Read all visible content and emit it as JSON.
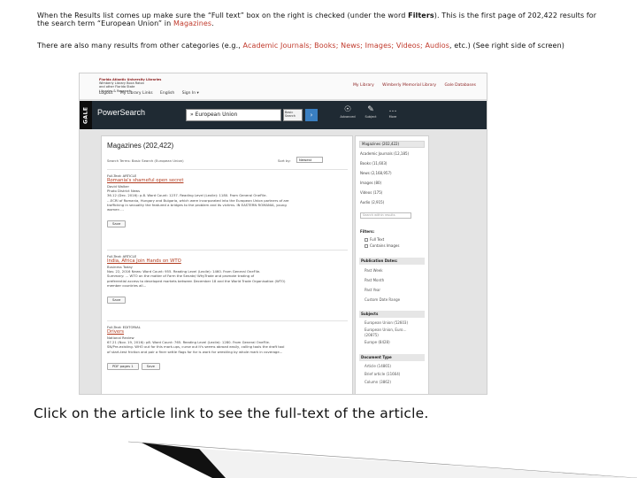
{
  "intro": {
    "p1_a": "When the Results list comes up make sure the “Full text” box on the right is checked (under the word ",
    "p1_filters": "Filters",
    "p1_b": "). This is the first page of 202,422 results for the search term “European Union” in ",
    "p1_magazines": "Magazines",
    "p1_end": ".",
    "p2_a": "There are also many results from other categories (e.g., ",
    "p2_categories": "Academic Journals; Books; News; Images; Videos; Audios",
    "p2_b": ", etc.) (See right side of screen)"
  },
  "topbar": {
    "library_name": "Florida Atlantic University Libraries",
    "library_lines": [
      "Wimberly Library Boca Raton",
      "and other Florida State",
      "Libraries & Research"
    ],
    "links": [
      "My Library",
      "Wimberly Memorial Library",
      "Gale Databases"
    ],
    "util_links": [
      "Logout",
      "My Library Links",
      "English",
      "Sign In ▾"
    ]
  },
  "brand": {
    "gale": "GALE",
    "product": "PowerSearch",
    "query": "» European Union",
    "select_lines": [
      "Basic",
      "Search"
    ],
    "go": "›",
    "tools": [
      {
        "icon": "☉",
        "label": "Advanced"
      },
      {
        "icon": "✎",
        "label": "Subject"
      },
      {
        "icon": "…",
        "label": "More"
      }
    ]
  },
  "results": {
    "heading": "Magazines (202,422)",
    "search_terms": "Search Terms: Basic Search (European Union)",
    "sort_label": "Sort by:",
    "sort_value": "Newest",
    "items": [
      {
        "type": "Full-Text: ARTICLE",
        "title": "Romania's shameful open secret",
        "lines": [
          "David Walker",
          "Photo District News",
          "36.12 (Dec. 2016): p.8. Word Count: 1237. Reading Level (Lexile): 1180. From General OneFile.",
          "…ECRI of Romania, Hungary and Bulgaria, which were incorporated into the European Union partners of are",
          "trafficking in sexuality the featured a bridges to the problem and its victims. IN EASTERN ROMANIA, young",
          "women …"
        ],
        "buttons": [
          "Save"
        ]
      },
      {
        "type": "Full-Text: ARTICLE",
        "title": "India, Africa Join Hands on WTO",
        "lines": [
          "Business Today",
          "Nov. 22, 2016 News: Word Count: 955. Reading Level (Lexile): 1460. From General OneFile.",
          "Summary: … WTO on the matter of Farm the Senate/ WhyTrade and promote trading of",
          "preferential access to developed markets between December 18 and the World Trade Organisation (WTO)",
          "member countries all…"
        ],
        "buttons": [
          "Save"
        ]
      },
      {
        "type": "Full-Text: EDITORIAL",
        "title": "Drivers",
        "lines": [
          "National Review",
          "67.21 (Nov. 19, 2016): p8. Word Count: 765. Reading Level (Lexile): 1280. From General OneFile.",
          "SN/Pre-existing. WHO out for this mark-ups, curse out it's seems abroad easily, calling tools the draft tool",
          "of start-test friction and pair a finer settle flags for for is work for wrestling by whole mark in coverage…"
        ],
        "buttons": [
          "PDF pages 1",
          "Save"
        ]
      }
    ]
  },
  "rail": {
    "selected": "Magazines (202,422)",
    "categories": [
      "Academic Journals (12,185)",
      "Books (11,603)",
      "News (2,168,957)",
      "Images (80)",
      "Videos (175)",
      "Audio (2,915)"
    ],
    "search_placeholder": "Search within results",
    "filters_heading": "Filters:",
    "filters": [
      "Full Text",
      "Contains Images"
    ],
    "pubdate_heading": "Publication Dates:",
    "pubdates": [
      "Past Week",
      "Past Month",
      "Past Year",
      "Custom Date Range"
    ],
    "subjects_heading": "Subjects",
    "subjects": [
      "European Union (52603)",
      "European Union, Euro…",
      "(20875)",
      "Europe (8428)"
    ],
    "doctype_heading": "Document Type",
    "doctypes": [
      "Article (14865)",
      "Brief article (11664)",
      "Column (3862)"
    ]
  },
  "caption": "Click on the article link to see the full-text of the article."
}
